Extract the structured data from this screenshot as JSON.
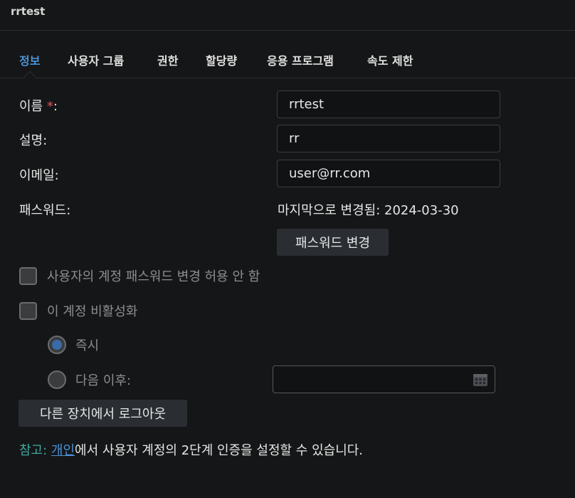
{
  "window": {
    "title": "rrtest"
  },
  "tabs": [
    {
      "label": "정보",
      "active": true
    },
    {
      "label": "사용자 그룹"
    },
    {
      "label": "권한"
    },
    {
      "label": "할당량"
    },
    {
      "label": "응용 프로그램"
    },
    {
      "label": "속도 제한"
    }
  ],
  "form": {
    "name_label": "이름",
    "name_required": "*",
    "name_colon": ":",
    "name_value": "rrtest",
    "desc_label": "설명:",
    "desc_value": "rr",
    "email_label": "이메일:",
    "email_value": "user@rr.com",
    "password_label": "패스워드:",
    "password_last_changed_label": "마지막으로 변경됨:",
    "password_last_changed_date": "2024-03-30",
    "change_password_button": "패스워드 변경"
  },
  "options": {
    "disallow_password_change_label": "사용자의 계정 패스워드 변경 허용 안 함",
    "disallow_password_change_checked": false,
    "disable_account_label": "이 계정 비활성화",
    "disable_account_checked": false,
    "immediately_label": "즉시",
    "immediately_selected": true,
    "after_label": "다음 이후:",
    "after_selected": false,
    "after_date_value": ""
  },
  "logout_button": "다른 장치에서 로그아웃",
  "note": {
    "prefix": "참고:",
    "link": "개인",
    "text": "에서 사용자 계정의 2단계 인증을 설정할 수 있습니다."
  },
  "colors": {
    "accent": "#4b93d9",
    "note_prefix": "#3fa9a0",
    "required": "#e05555",
    "background": "#151617"
  },
  "icons": {
    "calendar": "calendar-icon"
  }
}
